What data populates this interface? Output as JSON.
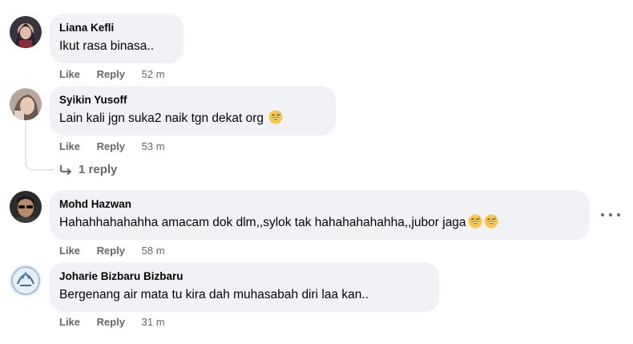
{
  "comments": [
    {
      "author": "Liana Kefli",
      "text": "Ikut rasa binasa..",
      "emojis": 0,
      "like": "Like",
      "reply": "Reply",
      "time": "52 m",
      "avatar": "avatar-woman-headscarf"
    },
    {
      "author": "Syikin Yusoff",
      "text": "Lain kali jgn suka2 naik tgn dekat org",
      "emojis": 1,
      "like": "Like",
      "reply": "Reply",
      "time": "53 m",
      "avatar": "avatar-woman-selfie"
    },
    {
      "author": "Mohd Hazwan",
      "text": "Hahahhahahahha amacam dok dlm,,sylok tak hahahahahahha,,jubor jaga",
      "emojis": 2,
      "like": "Like",
      "reply": "Reply",
      "time": "58 m",
      "avatar": "avatar-man-sunglasses"
    },
    {
      "author": "Joharie Bizbaru Bizbaru",
      "text": "Bergenang air mata tu kira dah muhasabah diri laa kan..",
      "emojis": 0,
      "like": "Like",
      "reply": "Reply",
      "time": "31 m",
      "avatar": "avatar-logo"
    }
  ],
  "thread": {
    "replies_label": "1 reply"
  },
  "icons": {
    "emoji": "grinning-sweat-emoji",
    "reply_arrow": "reply-arrow-icon",
    "more": "more-options-icon"
  },
  "colors": {
    "bubble": "#f0f2f5",
    "meta": "#65676b",
    "text": "#050505",
    "emoji": "#f7c64b"
  }
}
